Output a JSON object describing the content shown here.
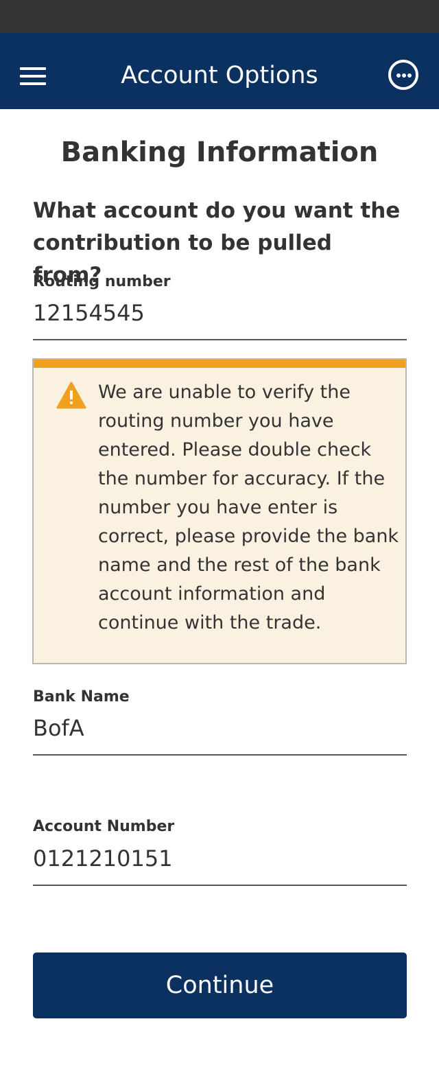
{
  "header": {
    "title": "Account Options",
    "menu_icon": "hamburger-menu-icon",
    "more_icon": "more-options-icon"
  },
  "section": {
    "title": "Banking Information",
    "question": "What account do you want the contribution to be pulled from?"
  },
  "routing": {
    "label": "Routing number",
    "value": "12154545"
  },
  "warning": {
    "icon": "warning-triangle-icon",
    "message": "We are unable to verify the routing number you have entered. Please double check the number for accuracy. If the number you have enter is correct, please provide the bank name and the rest of the bank account information and continue with the trade."
  },
  "bank_name": {
    "label": "Bank Name",
    "value": "BofA"
  },
  "account_number": {
    "label": "Account Number",
    "value": "0121210151"
  },
  "actions": {
    "continue_label": "Continue"
  },
  "colors": {
    "primary": "#0a3160",
    "warning_accent": "#f0a01f",
    "warning_background": "#fbf1e1"
  }
}
